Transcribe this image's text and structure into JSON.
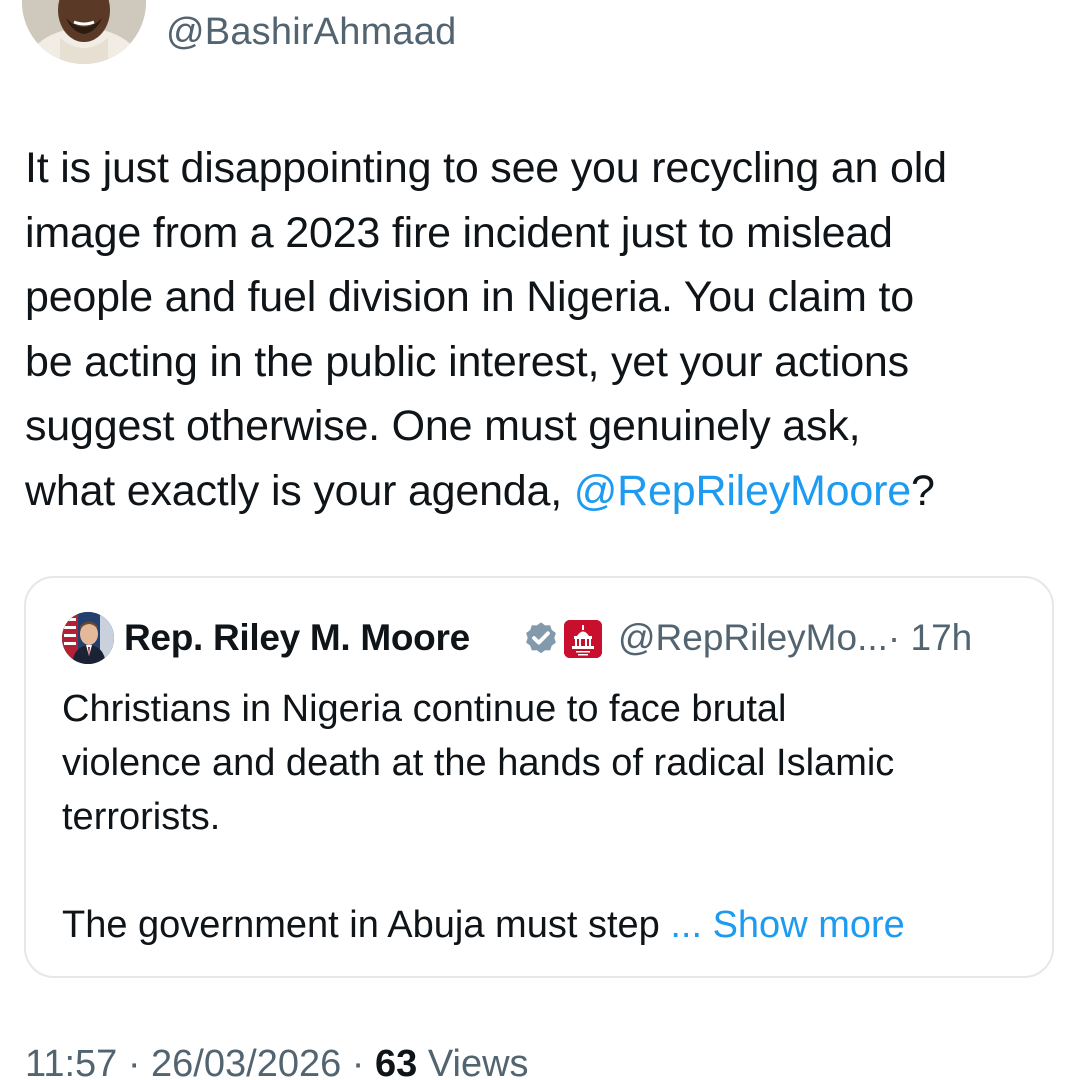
{
  "author": {
    "handle": "@BashirAhmaad"
  },
  "tweet": {
    "lines": [
      "It is just disappointing to see you recycling an old",
      "image from a 2023 fire incident just to mislead",
      "people and fuel division in Nigeria. You claim to",
      "be acting in the public interest, yet your actions",
      "suggest otherwise. One must genuinely ask,"
    ],
    "last_line_prefix": "what exactly is your agenda, ",
    "mention": "@RepRileyMoore",
    "last_line_suffix": "?"
  },
  "quote": {
    "name": "Rep. Riley M. Moore",
    "handle": "@RepRileyMo...",
    "time": "· 17h",
    "lines": [
      "Christians in Nigeria continue to face brutal",
      "violence and death at the hands of radical Islamic",
      "terrorists."
    ],
    "truncated_line": "The government in Abuja must step ",
    "show_more": "... Show more",
    "verified_icon": "verified-badge-icon",
    "affiliation_icon": "house-gop-badge-icon"
  },
  "meta": {
    "time_date": "11:57 · 26/03/2026 · ",
    "views_count": "63",
    "views_label": " Views"
  },
  "colors": {
    "accent": "#1d9bf0",
    "text": "#0f1419",
    "secondary": "#536471",
    "border": "#e5e7ea",
    "gop_red": "#c8102e"
  }
}
